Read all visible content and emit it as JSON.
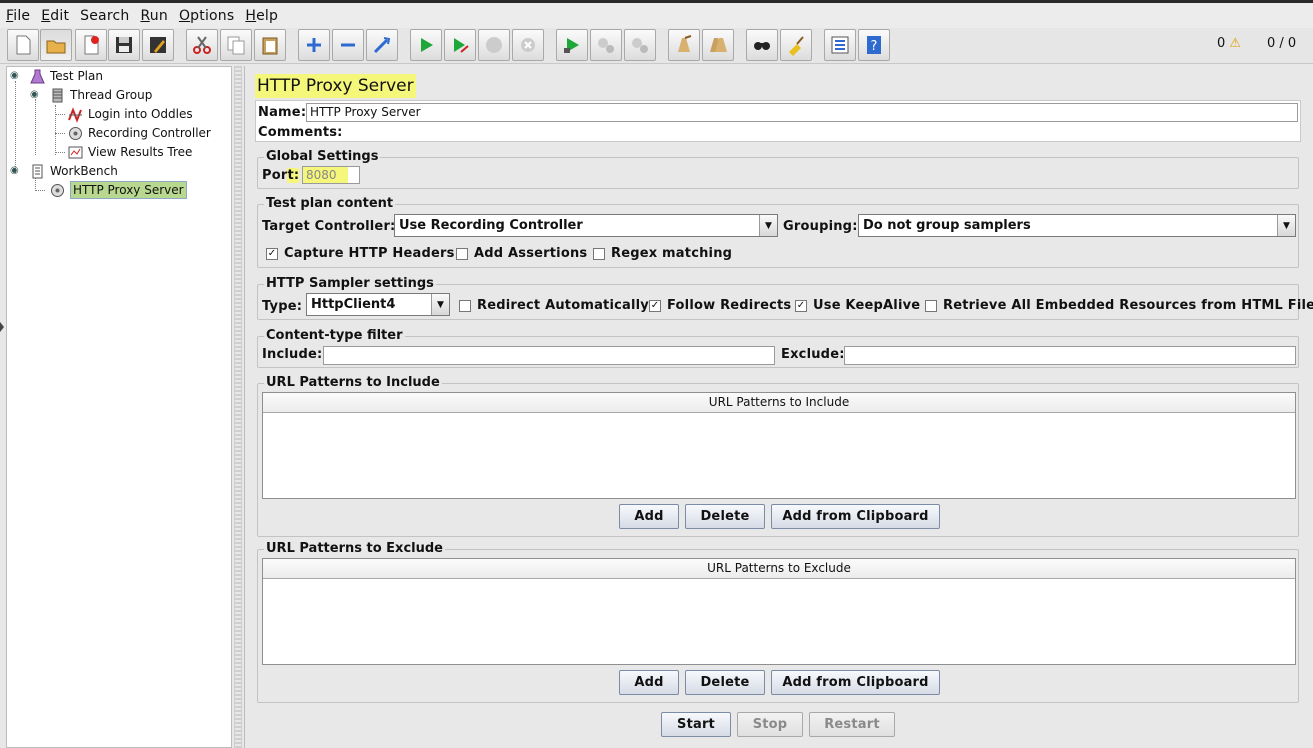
{
  "menu": [
    {
      "u": "F",
      "rest": "ile"
    },
    {
      "u": "E",
      "rest": "dit"
    },
    {
      "u": "",
      "rest": "Search"
    },
    {
      "u": "R",
      "rest": "un"
    },
    {
      "u": "O",
      "rest": "ptions"
    },
    {
      "u": "H",
      "rest": "elp"
    }
  ],
  "toolbar": {
    "icons": [
      "new-icon",
      "open-icon",
      "close-icon",
      "save-icon",
      "save-as-icon",
      "cut-icon",
      "copy-icon",
      "paste-icon",
      "expand-icon",
      "collapse-icon",
      "toggle-icon",
      "start-icon",
      "start-no-pause-icon",
      "stop-icon",
      "shutdown-icon",
      "remote-start-icon",
      "remote-stop-icon",
      "remote-shutdown-icon",
      "clear-icon",
      "clear-all-icon",
      "search-icon",
      "reset-search-icon",
      "function-helper-icon",
      "help-icon"
    ],
    "error_count": "0",
    "thread_count": "0 / 0"
  },
  "tree": {
    "nodes": [
      {
        "label": "Test Plan",
        "icon": "test-plan-icon"
      },
      {
        "label": "Thread Group",
        "icon": "thread-group-icon"
      },
      {
        "label": "Login into Oddles",
        "icon": "sampler-icon"
      },
      {
        "label": "Recording Controller",
        "icon": "recording-controller-icon"
      },
      {
        "label": "View Results Tree",
        "icon": "listener-icon"
      },
      {
        "label": "WorkBench",
        "icon": "workbench-icon"
      },
      {
        "label": "HTTP Proxy Server",
        "icon": "proxy-server-icon"
      }
    ]
  },
  "panel": {
    "title": "HTTP Proxy Server",
    "name_label": "Name:",
    "name_value": "HTTP Proxy Server",
    "comments_label": "Comments:",
    "global": {
      "title": "Global Settings",
      "port_label_a": "Por",
      "port_label_b": "t:",
      "port_value": "8080"
    },
    "test_plan": {
      "title": "Test plan content",
      "target_label": "Target Controller:",
      "target_value": "Use Recording Controller",
      "grouping_label": "Grouping:",
      "grouping_value": "Do not group samplers",
      "capture_headers": "Capture HTTP Headers",
      "add_assertions": "Add Assertions",
      "regex_matching": "Regex matching"
    },
    "sampler": {
      "title": "HTTP Sampler settings",
      "type_label": "Type:",
      "type_value": "HttpClient4",
      "redirect_auto": "Redirect Automatically",
      "follow_redirects": "Follow Redirects",
      "keepalive": "Use KeepAlive",
      "retrieve_embedded": "Retrieve All Embedded Resources from HTML Files"
    },
    "content_type": {
      "title": "Content-type filter",
      "include_label": "Include:",
      "exclude_label": "Exclude:"
    },
    "include_patterns": {
      "title": "URL Patterns to Include",
      "column": "URL Patterns to Include"
    },
    "exclude_patterns": {
      "title": "URL Patterns to Exclude",
      "column": "URL Patterns to Exclude"
    },
    "buttons": {
      "add": "Add",
      "delete": "Delete",
      "add_clipboard": "Add from Clipboard",
      "start": "Start",
      "stop": "Stop",
      "restart": "Restart"
    }
  },
  "colors": {
    "highlight": "#f4f77a",
    "selection": "#b9d88f"
  }
}
